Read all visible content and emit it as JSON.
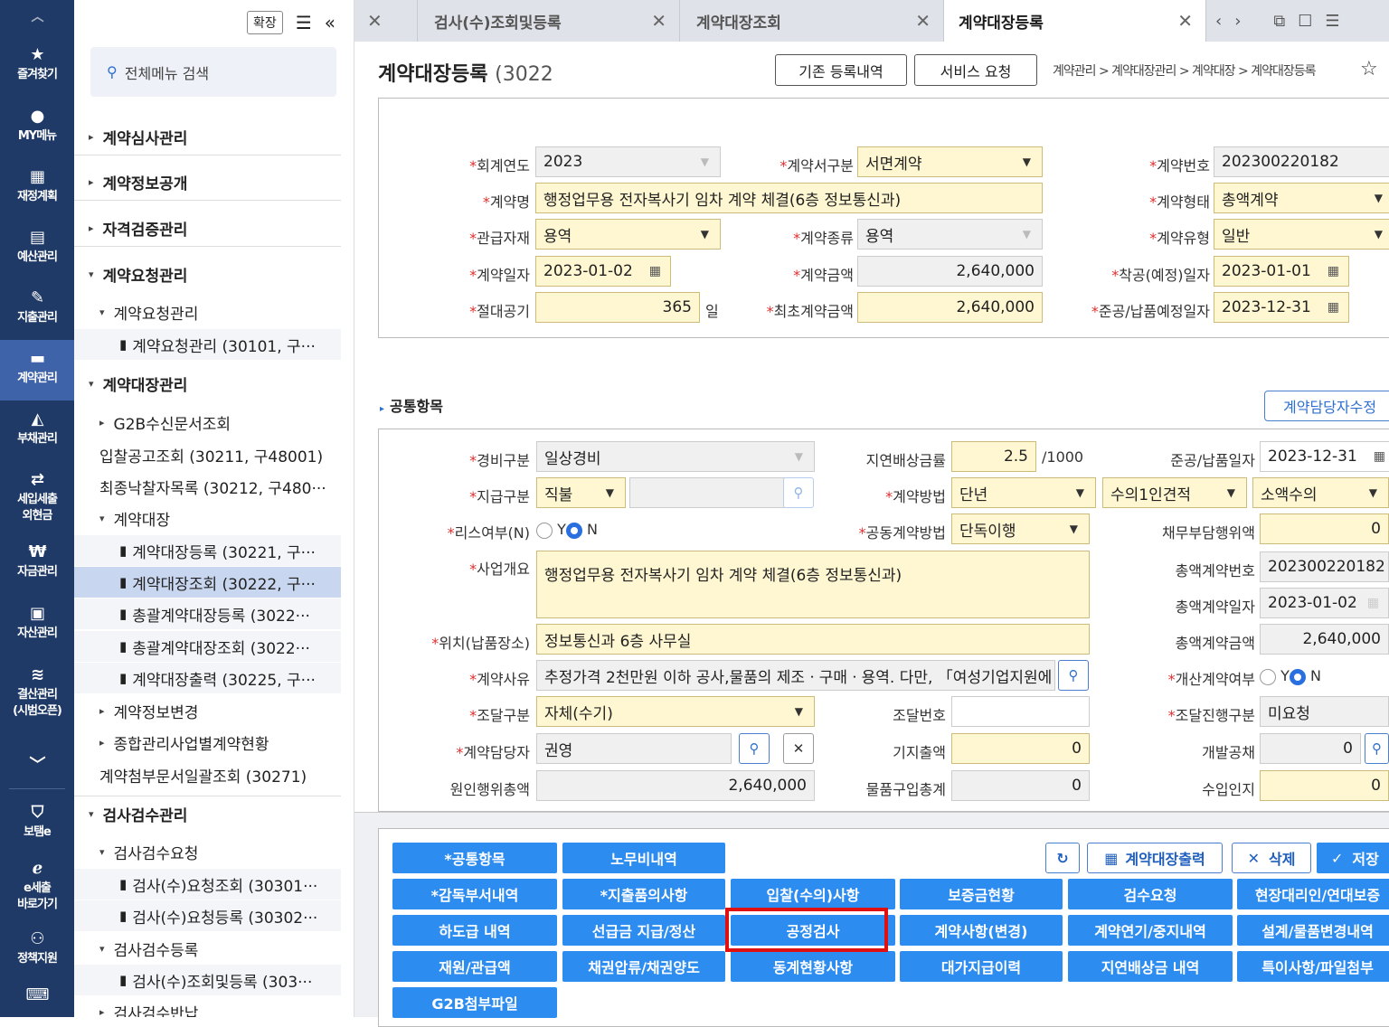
{
  "leftnav": {
    "items": [
      {
        "label": "즐겨찾기",
        "icon": "star-icon"
      },
      {
        "label": "MY메뉴",
        "icon": "user-icon"
      },
      {
        "label": "재정계획",
        "icon": "calendar-icon"
      },
      {
        "label": "예산관리",
        "icon": "document-icon"
      },
      {
        "label": "지출관리",
        "icon": "pen-icon"
      },
      {
        "label": "계약관리",
        "icon": "contract-icon"
      },
      {
        "label": "부채관리",
        "icon": "debt-icon"
      },
      {
        "label": "세입세출\n외현금",
        "icon": "cash-icon"
      },
      {
        "label": "자금관리",
        "icon": "won-icon"
      },
      {
        "label": "자산관리",
        "icon": "briefcase-icon"
      },
      {
        "label": "결산관리\n(시범오픈)",
        "icon": "layers-icon"
      },
      {
        "label": "보탬e",
        "icon": "shield-icon"
      },
      {
        "label": "e세출\n바로가기",
        "icon": "e-icon"
      },
      {
        "label": "정책지원",
        "icon": "people-icon"
      }
    ]
  },
  "menupanel": {
    "expand_label": "확장",
    "search_placeholder": "전체메뉴 검색",
    "items": [
      "계약심사관리",
      "계약정보공개",
      "자격검증관리",
      "계약요청관리",
      "계약요청관리",
      "계약요청관리 (30101, 구···",
      "계약대장관리",
      "G2B수신문서조회",
      "입찰공고조회 (30211, 구48001)",
      "최종낙찰자목록 (30212, 구480···",
      "계약대장",
      "계약대장등록 (30221, 구···",
      "계약대장조회 (30222, 구···",
      "총괄계약대장등록 (3022···",
      "총괄계약대장조회 (3022···",
      "계약대장출력 (30225, 구···",
      "계약정보변경",
      "종합관리사업별계약현황",
      "계약첨부문서일괄조회 (30271)",
      "검사검수관리",
      "검사검수요청",
      "검사(수)요청조회 (30301···",
      "검사(수)요청등록 (30302···",
      "검사검수등록",
      "검사(수)조회및등록 (303···",
      "검사검수반납"
    ]
  },
  "tabs": [
    {
      "label": "검사(수)조회및등록"
    },
    {
      "label": "계약대장조회"
    },
    {
      "label": "계약대장등록"
    }
  ],
  "page": {
    "title": "계약대장등록",
    "code": "(3022",
    "btn_history": "기존 등록내역",
    "btn_service": "서비스 요청",
    "breadcrumb": "계약관리 > 계약대장관리 > 계약대장 > 계약대장등록"
  },
  "form": {
    "labels": {
      "year": "회계연도",
      "doc_type": "계약서구분",
      "contract_no": "계약번호",
      "name": "계약명",
      "form": "계약형태",
      "material": "관급자재",
      "kind": "계약종류",
      "ctype": "계약유형",
      "date": "계약일자",
      "amount": "계약금액",
      "start": "착공(예정)일자",
      "period": "절대공기",
      "init_amount": "최초계약금액",
      "end": "준공/납품예정일자",
      "day_unit": "일"
    },
    "values": {
      "year": "2023",
      "doc_type": "서면계약",
      "contract_no": "202300220182",
      "name": "행정업무용 전자복사기 임차 계약 체결(6층 정보통신과)",
      "form": "총액계약",
      "material": "용역",
      "kind": "용역",
      "ctype": "일반",
      "date": "2023-01-02",
      "amount": "2,640,000",
      "start": "2023-01-01",
      "period": "365",
      "init_amount": "2,640,000",
      "end": "2023-12-31"
    }
  },
  "common": {
    "title": "공통항목",
    "manager_btn": "계약담당자수정",
    "labels": {
      "expense": "경비구분",
      "delay_rate": "지연배상금률",
      "rate_unit": "/1000",
      "complete": "준공/납품일자",
      "pay": "지급구분",
      "method": "계약방법",
      "lease": "리스여부(N)",
      "joint": "공동계약방법",
      "debt": "채무부담행위액",
      "summary": "사업개요",
      "total_no": "총액계약번호",
      "total_date": "총액계약일자",
      "total_amt": "총액계약금액",
      "location": "위치(납품장소)",
      "reason": "계약사유",
      "private": "개산계약여부",
      "procure": "조달구분",
      "procure_no": "조달번호",
      "procure_status": "조달진행구분",
      "manager": "계약담당자",
      "prepaid": "기지출액",
      "dev": "개발공채",
      "cause_total": "원인행위총액",
      "purchase": "물품구입총계",
      "stamp": "수입인지",
      "yes": "Y",
      "no": "N"
    },
    "values": {
      "expense": "일상경비",
      "delay_rate": "2.5",
      "complete": "2023-12-31",
      "pay": "직불",
      "method": "단년",
      "method2": "수의1인견적",
      "method3": "소액수의",
      "joint": "단독이행",
      "debt": "0",
      "summary": "행정업무용 전자복사기 임차 계약 체결(6층 정보통신과)",
      "total_no": "202300220182",
      "total_date": "2023-01-02",
      "total_amt": "2,640,000",
      "location": "정보통신과 6층 사무실",
      "reason": "추정가격 2천만원 이하 공사,물품의 제조ㆍ구매ㆍ용역. 다만, 「여성기업지원에",
      "procure": "자체(수기)",
      "procure_no": "",
      "procure_status": "미요청",
      "manager": "권영",
      "prepaid": "0",
      "dev": "0",
      "cause_total": "2,640,000",
      "purchase": "0",
      "stamp": "0"
    }
  },
  "actions": {
    "refresh": "",
    "print": "계약대장출력",
    "delete": "삭제",
    "save": "저장"
  },
  "buttons": [
    [
      "*공통항목",
      "노무비내역"
    ],
    [
      "*감독부서내역",
      "*지출품의사항",
      "입찰(수의)사항",
      "보증금현황",
      "검수요청",
      "현장대리인/연대보증"
    ],
    [
      "하도급 내역",
      "선급금 지급/정산",
      "공정검사",
      "계약사항(변경)",
      "계약연기/중지내역",
      "설계/물품변경내역"
    ],
    [
      "재원/관급액",
      "채권압류/채권양도",
      "동계현황사항",
      "대가지급이력",
      "지연배상금 내역",
      "특이사항/파일첨부"
    ],
    [
      "G2B첨부파일"
    ]
  ],
  "colors": {
    "nav": "#1f3a66",
    "accent": "#2d8cf0",
    "highlight": "#e01010"
  }
}
